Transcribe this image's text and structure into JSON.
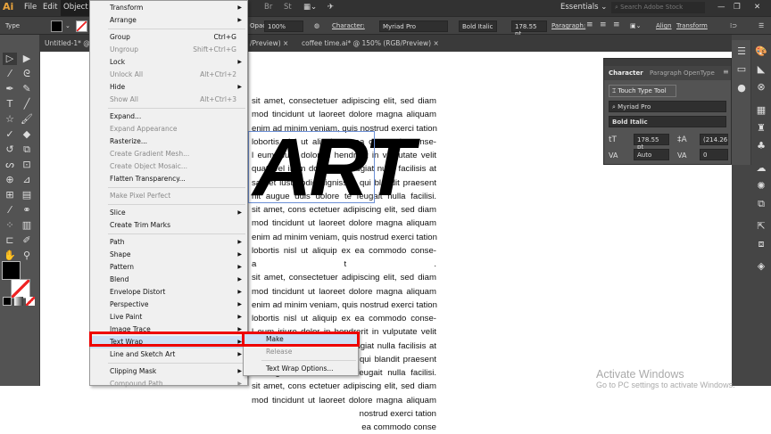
{
  "menubar": {
    "logo": "Ai",
    "items": [
      "File",
      "Edit",
      "Object"
    ],
    "workspace": "Essentials",
    "search_placeholder": "Search Adobe Stock",
    "icons": [
      "bridge-icon",
      "stock-icon",
      "arrange-documents-icon",
      "gpu-performance-icon"
    ]
  },
  "control": {
    "tool_label": "Type",
    "opacity_label": "Opacity:",
    "opacity": "100%",
    "character_label": "Character:",
    "font": "Myriad Pro",
    "style": "Bold Italic",
    "size": "178.55 pt",
    "paragraph_label": "Paragraph:",
    "align_label": "Align",
    "transform_label": "Transform"
  },
  "tabs": [
    {
      "label": "Untitled-1* @ 6"
    },
    {
      "label": "/Preview)"
    },
    {
      "label": "coffee time.ai* @ 150% (RGB/Preview)"
    }
  ],
  "object_menu": {
    "items": [
      {
        "label": "Transform",
        "sub": true
      },
      {
        "label": "Arrange",
        "sub": true
      },
      {
        "label": "Group",
        "shortcut": "Ctrl+G"
      },
      {
        "label": "Ungroup",
        "shortcut": "Shift+Ctrl+G",
        "disabled": true
      },
      {
        "label": "Lock",
        "sub": true
      },
      {
        "label": "Unlock All",
        "shortcut": "Alt+Ctrl+2",
        "disabled": true
      },
      {
        "label": "Hide",
        "sub": true
      },
      {
        "label": "Show All",
        "shortcut": "Alt+Ctrl+3",
        "disabled": true
      },
      {
        "label": "Expand..."
      },
      {
        "label": "Expand Appearance",
        "disabled": true
      },
      {
        "label": "Rasterize..."
      },
      {
        "label": "Create Gradient Mesh...",
        "disabled": true
      },
      {
        "label": "Create Object Mosaic...",
        "disabled": true
      },
      {
        "label": "Flatten Transparency..."
      },
      {
        "label": "Make Pixel Perfect",
        "disabled": true
      },
      {
        "label": "Slice",
        "sub": true
      },
      {
        "label": "Create Trim Marks"
      },
      {
        "label": "Path",
        "sub": true
      },
      {
        "label": "Shape",
        "sub": true
      },
      {
        "label": "Pattern",
        "sub": true
      },
      {
        "label": "Blend",
        "sub": true
      },
      {
        "label": "Envelope Distort",
        "sub": true
      },
      {
        "label": "Perspective",
        "sub": true
      },
      {
        "label": "Live Paint",
        "sub": true
      },
      {
        "label": "Image Trace",
        "sub": true
      },
      {
        "label": "Text Wrap",
        "sub": true,
        "highlighted": true
      },
      {
        "label": "Line and Sketch Art",
        "sub": true
      },
      {
        "label": "Clipping Mask",
        "sub": true
      },
      {
        "label": "Compound Path",
        "sub": true,
        "disabled": true
      }
    ]
  },
  "text_wrap_submenu": {
    "items": [
      {
        "label": "Make",
        "highlighted": true
      },
      {
        "label": "Release",
        "disabled": true
      },
      {
        "label": "Text Wrap Options..."
      }
    ]
  },
  "document": {
    "art_text": "ART",
    "lines": [
      "sit amet, consectetuer adipiscing elit, sed diam",
      "mod tincidunt ut laoreet dolore magna aliquam",
      "enim ad minim veniam, quis nostrud exerci tation",
      "lobortis nisl ut aliquip ex ea commodo conse-",
      "l eum iriure dolor in hendrerit in vulputate velit",
      "quat, vel illum dolore eu feugiat nulla facilisis at",
      "san et iusto odio dignissim qui blandit praesent",
      "nit augue duis dolore te feugait nulla facilisi.",
      "sit amet, cons ectetuer adipiscing elit, sed diam",
      "mod tincidunt ut laoreet dolore magna aliquam",
      "enim ad minim veniam, quis nostrud exerci tation",
      "lobortis nisl ut aliquip ex ea commodo conse-",
      "a t .",
      "sit amet, consectetuer adipiscing elit, sed diam",
      "mod tincidunt ut laoreet dolore magna aliquam",
      "enim ad minim veniam, quis nostrud exerci tation",
      "lobortis nisl ut aliquip ex ea commodo conse-",
      "l eum iriure dolor in hendrerit in vulputate velit",
      "quat, vel illum dolore eu feugiat nulla facilisis at",
      "san et iusto odio dignissim qui blandit praesent",
      "nit augue duis dolore te feugait nulla facilisi.",
      "sit amet, cons ectetuer adipiscing elit, sed diam",
      "mod tincidunt ut laoreet dolore magna aliquam",
      "nostrud exerci tation",
      "ea commodo conse"
    ]
  },
  "character_panel": {
    "tabs": [
      "Character",
      "Paragraph",
      "OpenType"
    ],
    "touch_type": "Touch Type Tool",
    "font": "Myriad Pro",
    "style": "Bold Italic",
    "size": "178.55 pt",
    "leading": "(214.26 p",
    "kerning": "Auto",
    "tracking": "0"
  },
  "watermark": {
    "line1": "Activate Windows",
    "line2": "Go to PC settings to activate Windows."
  },
  "colors": {
    "highlight": "#cde0f5",
    "annotation_red": "#e00000",
    "selection": "#6b8fd6"
  }
}
